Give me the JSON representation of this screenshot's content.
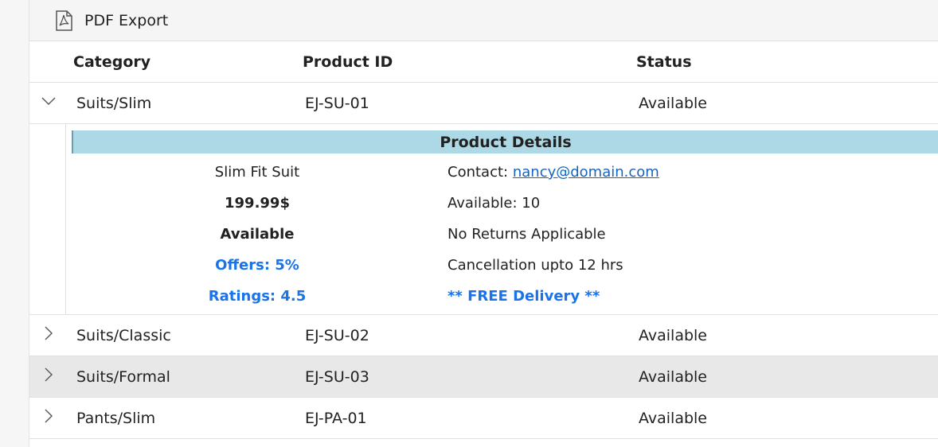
{
  "toolbar": {
    "pdf_export_label": "PDF Export"
  },
  "columns": {
    "category": "Category",
    "product_id": "Product ID",
    "status": "Status"
  },
  "rows": [
    {
      "category": "Suits/Slim",
      "product_id": "EJ-SU-01",
      "status": "Available",
      "expanded": true
    },
    {
      "category": "Suits/Classic",
      "product_id": "EJ-SU-02",
      "status": "Available",
      "expanded": false
    },
    {
      "category": "Suits/Formal",
      "product_id": "EJ-SU-03",
      "status": "Available",
      "expanded": false
    },
    {
      "category": "Pants/Slim",
      "product_id": "EJ-PA-01",
      "status": "Available",
      "expanded": false
    }
  ],
  "detail": {
    "title": "Product Details",
    "name": "Slim Fit Suit",
    "price": "199.99$",
    "availability": "Available",
    "offers": "Offers: 5%",
    "ratings": "Ratings: 4.5",
    "contact_label": "Contact:",
    "contact_email": "nancy@domain.com",
    "available_count": "Available: 10",
    "returns": "No Returns Applicable",
    "cancellation": "Cancellation upto 12 hrs",
    "delivery": "** FREE Delivery **"
  },
  "colors": {
    "detail_header_bg": "#add8e6",
    "accent_blue": "#1a73e8",
    "selected_row_bg": "#e8e8e8"
  }
}
